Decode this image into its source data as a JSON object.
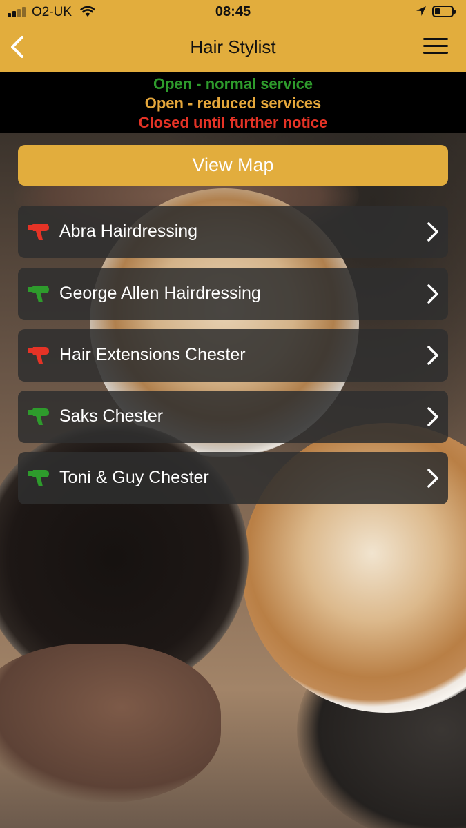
{
  "status_bar": {
    "carrier": "O2-UK",
    "time": "08:45"
  },
  "nav": {
    "title": "Hair Stylist"
  },
  "legend": {
    "open_normal": "Open - normal service",
    "open_reduced": "Open - reduced services",
    "closed": "Closed until further notice"
  },
  "colors": {
    "accent": "#e2ad3d",
    "open": "#2e9b2c",
    "reduced": "#e5a73b",
    "closed": "#e53326"
  },
  "view_map_label": "View Map",
  "listings": [
    {
      "name": "Abra Hairdressing",
      "status": "closed",
      "icon": "hair-dryer-icon"
    },
    {
      "name": "George Allen Hairdressing",
      "status": "open",
      "icon": "hair-dryer-icon"
    },
    {
      "name": "Hair Extensions Chester",
      "status": "closed",
      "icon": "hair-dryer-icon"
    },
    {
      "name": "Saks Chester",
      "status": "open",
      "icon": "hair-dryer-icon"
    },
    {
      "name": "Toni & Guy Chester",
      "status": "open",
      "icon": "hair-dryer-icon"
    }
  ]
}
